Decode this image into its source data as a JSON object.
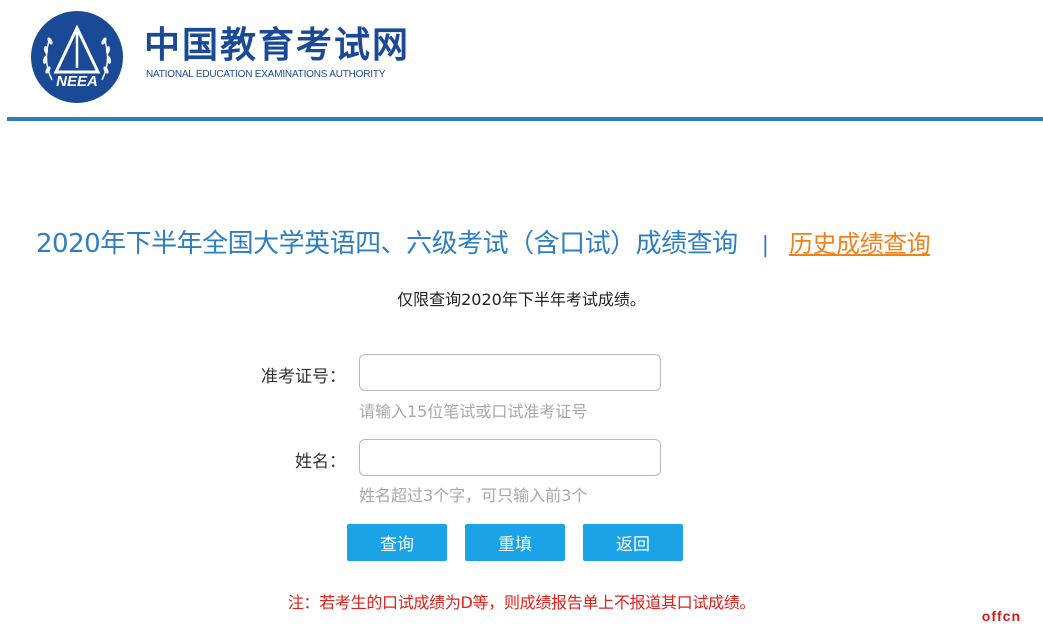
{
  "header": {
    "site_name": "中国教育考试网",
    "site_name_en": "NATIONAL EDUCATION EXAMINATIONS AUTHORITY",
    "emblem_text": "NEEA",
    "brand_color": "#1a4a96",
    "rule_color": "#2d7dc0"
  },
  "main": {
    "title": "2020年下半年全国大学英语四、六级考试（含口试）成绩查询",
    "separator": "|",
    "history_link": "历史成绩查询",
    "notice": "仅限查询2020年下半年考试成绩。",
    "title_color": "#2e7ec1",
    "link_color": "#f0821e"
  },
  "form": {
    "exam_id": {
      "label": "准考证号：",
      "value": "",
      "hint": "请输入15位笔试或口试准考证号"
    },
    "name": {
      "label": "姓名：",
      "value": "",
      "hint": "姓名超过3个字，可只输入前3个"
    },
    "buttons": {
      "query": "查询",
      "reset": "重填",
      "back": "返回"
    },
    "button_color": "#1aa3e6"
  },
  "footer": {
    "note": "注：若考生的口试成绩为D等，则成绩报告单上不报道其口试成绩。",
    "note_color": "#e0201b",
    "watermark": "offcn"
  }
}
